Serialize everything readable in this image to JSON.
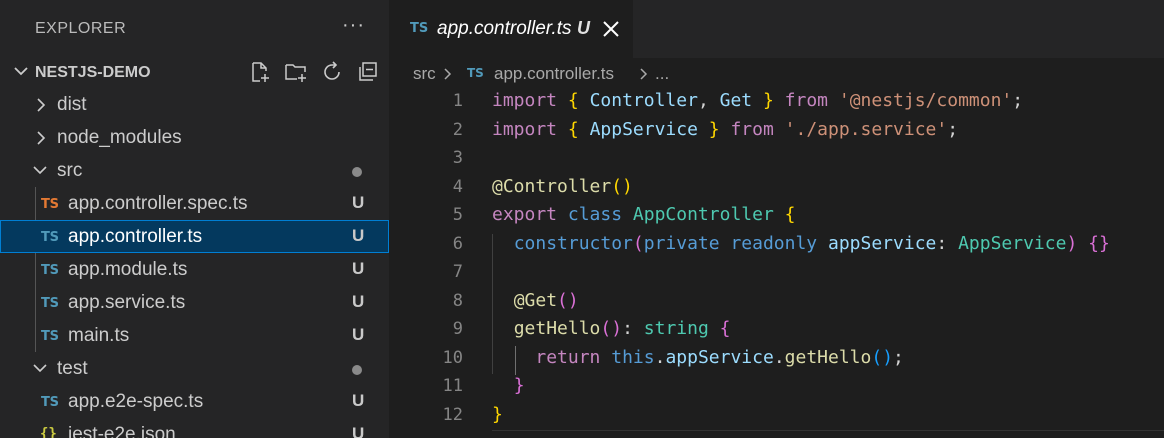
{
  "sidebar": {
    "title": "EXPLORER",
    "more_label": "···",
    "project": "NESTJS-DEMO",
    "actions": [
      "new-file-icon",
      "new-folder-icon",
      "refresh-icon",
      "collapse-all-icon"
    ],
    "items": [
      {
        "label": "dist",
        "type": "folder",
        "expanded": false
      },
      {
        "label": "node_modules",
        "type": "folder",
        "expanded": false
      },
      {
        "label": "src",
        "type": "folder",
        "expanded": true
      },
      {
        "label": "app.controller.spec.ts",
        "badge": "TS",
        "status": "U"
      },
      {
        "label": "app.controller.ts",
        "badge": "TS",
        "status": "U",
        "selected": true
      },
      {
        "label": "app.module.ts",
        "badge": "TS",
        "status": "U"
      },
      {
        "label": "app.service.ts",
        "badge": "TS",
        "status": "U"
      },
      {
        "label": "main.ts",
        "badge": "TS",
        "status": "U"
      },
      {
        "label": "test",
        "type": "folder",
        "expanded": true
      },
      {
        "label": "app.e2e-spec.ts",
        "badge": "TS",
        "status": "U"
      },
      {
        "label": "jest-e2e.json",
        "badge": "{}",
        "status": "U"
      }
    ]
  },
  "editor": {
    "tab": {
      "badge": "TS",
      "name": "app.controller.ts",
      "status": "U"
    },
    "breadcrumb": {
      "folder": "src",
      "badge": "TS",
      "file": "app.controller.ts",
      "more": "..."
    },
    "line_numbers": [
      "1",
      "2",
      "3",
      "4",
      "5",
      "6",
      "7",
      "8",
      "9",
      "10",
      "11",
      "12"
    ]
  },
  "colors": {
    "accent": "#007fd4",
    "ts_blue": "#519aba",
    "ts_orange": "#e37933"
  }
}
